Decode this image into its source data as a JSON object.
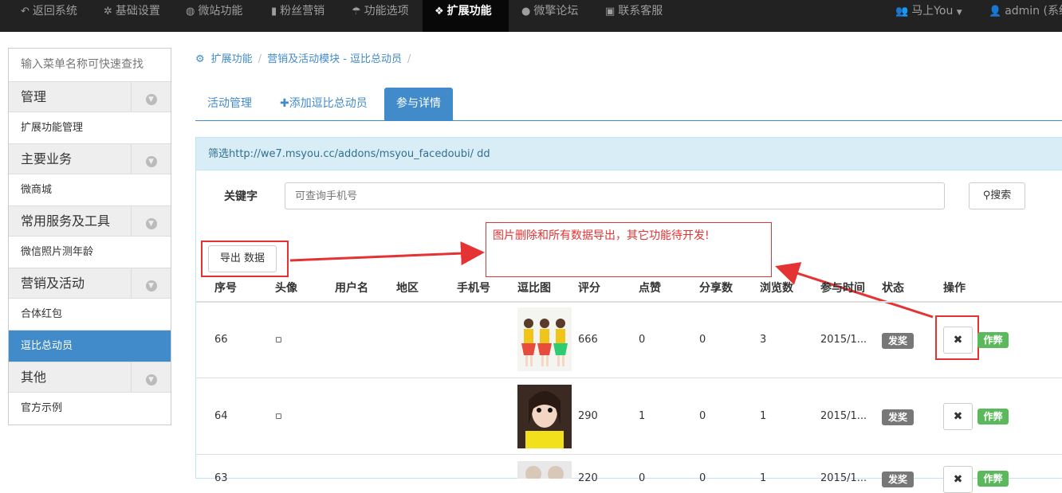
{
  "topnav": {
    "items": [
      {
        "label": "返回系统",
        "icon": "undo-icon"
      },
      {
        "label": "基础设置",
        "icon": "gear-icon"
      },
      {
        "label": "微站功能",
        "icon": "globe-icon"
      },
      {
        "label": "粉丝营销",
        "icon": "bookmark-icon"
      },
      {
        "label": "功能选项",
        "icon": "umbrella-icon"
      },
      {
        "label": "扩展功能",
        "icon": "cubes-icon"
      },
      {
        "label": "微擎论坛",
        "icon": "comment-icon"
      },
      {
        "label": "联系客服",
        "icon": "briefcase-icon"
      }
    ],
    "user_group": "马上You",
    "admin": "admin (系统"
  },
  "sidebar": {
    "search_placeholder": "输入菜单名称可快速查找",
    "groups": [
      {
        "title": "管理",
        "links": [
          "扩展功能管理"
        ]
      },
      {
        "title": "主要业务",
        "links": [
          "微商城"
        ]
      },
      {
        "title": "常用服务及工具",
        "links": [
          "微信照片测年龄"
        ]
      },
      {
        "title": "营销及活动",
        "links": [
          "合体红包",
          "逗比总动员"
        ]
      },
      {
        "title": "其他",
        "links": [
          "官方示例"
        ]
      }
    ]
  },
  "breadcrumb": [
    "扩展功能",
    "营销及活动模块 - 逗比总动员"
  ],
  "tabs": [
    "活动管理",
    "添加逗比总动员",
    "参与详情"
  ],
  "panel": {
    "filter_title": "筛选http://we7.msyou.cc/addons/msyou_facedoubi/ dd",
    "keyword_label": "关键字",
    "keyword_placeholder": "可查询手机号",
    "search_label": "搜索",
    "export_label": "导出 数据"
  },
  "annotation": "图片删除和所有数据导出，其它功能待开发!",
  "table": {
    "headers": [
      "序号",
      "头像",
      "用户名",
      "地区",
      "手机号",
      "逗比图",
      "评分",
      "点赞",
      "分享数",
      "浏览数",
      "参与时间",
      "状态",
      "操作"
    ],
    "rows": [
      {
        "id": "66",
        "avatar": "▫",
        "score": "666",
        "likes": "0",
        "shares": "0",
        "views": "3",
        "time": "2015/1...",
        "status": "发奖",
        "op": "作弊"
      },
      {
        "id": "64",
        "avatar": "▫",
        "score": "290",
        "likes": "1",
        "shares": "0",
        "views": "1",
        "time": "2015/1...",
        "status": "发奖",
        "op": "作弊"
      },
      {
        "id": "63",
        "avatar": "",
        "score": "220",
        "likes": "0",
        "shares": "0",
        "views": "1",
        "time": "2015/1...",
        "status": "发奖",
        "op": "作弊"
      }
    ]
  },
  "colors": {
    "accent": "#428bca",
    "annotation": "#e53333",
    "success": "#5cb85c",
    "topbar": "#222222"
  }
}
